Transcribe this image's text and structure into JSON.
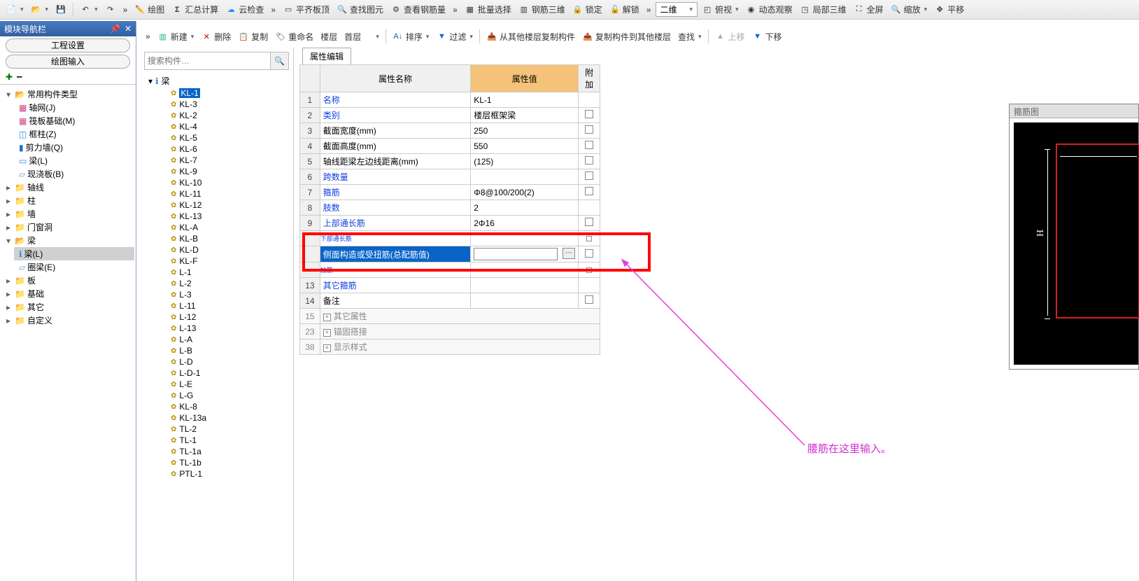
{
  "topbar": {
    "draw": "绘图",
    "sum": "汇总计算",
    "cloud": "云检查",
    "flat": "平齐板顶",
    "find": "查找图元",
    "rebarqty": "查看钢筋量",
    "batch": "批量选择",
    "rebar3d": "钢筋三维",
    "lock": "锁定",
    "unlock": "解锁",
    "viewmode": "二维",
    "topview": "俯视",
    "dynview": "动态观察",
    "local3d": "局部三维",
    "full": "全屏",
    "zoom": "缩放",
    "pan": "平移"
  },
  "subbar": {
    "new": "新建",
    "del": "删除",
    "copy": "复制",
    "rename": "重命名",
    "floor": "楼层",
    "firstfloor": "首层",
    "sort": "排序",
    "filter": "过滤",
    "copyfrom": "从其他楼层复制构件",
    "copyto": "复制构件到其他楼层",
    "findcmp": "查找",
    "up": "上移",
    "down": "下移"
  },
  "nav": {
    "title": "模块导航栏",
    "tab1": "工程设置",
    "tab2": "绘图输入",
    "common": "常用构件类型",
    "items": [
      "轴网(J)",
      "筏板基础(M)",
      "框柱(Z)",
      "剪力墙(Q)",
      "梁(L)",
      "现浇板(B)"
    ],
    "groups": [
      "轴线",
      "柱",
      "墙",
      "门窗洞",
      "梁",
      "板",
      "基础",
      "其它",
      "自定义"
    ],
    "beam_sub": [
      "梁(L)",
      "圈梁(E)"
    ]
  },
  "search_placeholder": "搜索构件…",
  "tree_root": "梁",
  "components": [
    "KL-1",
    "KL-3",
    "KL-2",
    "KL-4",
    "KL-5",
    "KL-6",
    "KL-7",
    "KL-9",
    "KL-10",
    "KL-11",
    "KL-12",
    "KL-13",
    "KL-A",
    "KL-B",
    "KL-D",
    "KL-F",
    "L-1",
    "L-2",
    "L-3",
    "L-11",
    "L-12",
    "L-13",
    "L-A",
    "L-B",
    "L-D",
    "L-D-1",
    "L-E",
    "L-G",
    "KL-8",
    "KL-13a",
    "TL-2",
    "TL-1",
    "TL-1a",
    "TL-1b",
    "PTL-1"
  ],
  "prop_tab": "属性编辑",
  "headers": {
    "name": "属性名称",
    "value": "属性值",
    "add": "附加"
  },
  "rows": [
    {
      "n": "1",
      "name": "名称",
      "val": "KL-1",
      "link": true,
      "chk": false
    },
    {
      "n": "2",
      "name": "类别",
      "val": "楼层框架梁",
      "link": true,
      "chk": true
    },
    {
      "n": "3",
      "name": "截面宽度(mm)",
      "val": "250",
      "link": false,
      "chk": true
    },
    {
      "n": "4",
      "name": "截面高度(mm)",
      "val": "550",
      "link": false,
      "chk": true
    },
    {
      "n": "5",
      "name": "轴线距梁左边线距离(mm)",
      "val": "(125)",
      "link": false,
      "chk": true
    },
    {
      "n": "6",
      "name": "跨数量",
      "val": "",
      "link": true,
      "chk": true
    },
    {
      "n": "7",
      "name": "箍筋",
      "val": "Φ8@100/200(2)",
      "link": true,
      "chk": true
    },
    {
      "n": "8",
      "name": "肢数",
      "val": "2",
      "link": true,
      "chk": false
    },
    {
      "n": "9",
      "name": "上部通长筋",
      "val": "2Φ16",
      "link": true,
      "chk": true
    },
    {
      "n": "h1",
      "name": "下部通长筋",
      "val": "",
      "link": true,
      "chk": true,
      "hidden": true
    },
    {
      "n": "sel",
      "name": "侧面构造或受扭筋(总配筋值)",
      "val": "",
      "link": true,
      "chk": true,
      "selected": true,
      "input": true
    },
    {
      "n": "h2",
      "name": "拉筋",
      "val": "",
      "link": true,
      "chk": true,
      "hidden": true
    },
    {
      "n": "13",
      "name": "其它箍筋",
      "val": "",
      "link": true,
      "chk": false
    },
    {
      "n": "14",
      "name": "备注",
      "val": "",
      "link": false,
      "chk": true
    },
    {
      "n": "15",
      "name": "其它属性",
      "group": true
    },
    {
      "n": "23",
      "name": "锚固搭接",
      "group": true
    },
    {
      "n": "38",
      "name": "显示样式",
      "group": true
    }
  ],
  "rebar_title": "箍筋图",
  "rebar_dim": "H",
  "annotation": "腰筋在这里输入。"
}
